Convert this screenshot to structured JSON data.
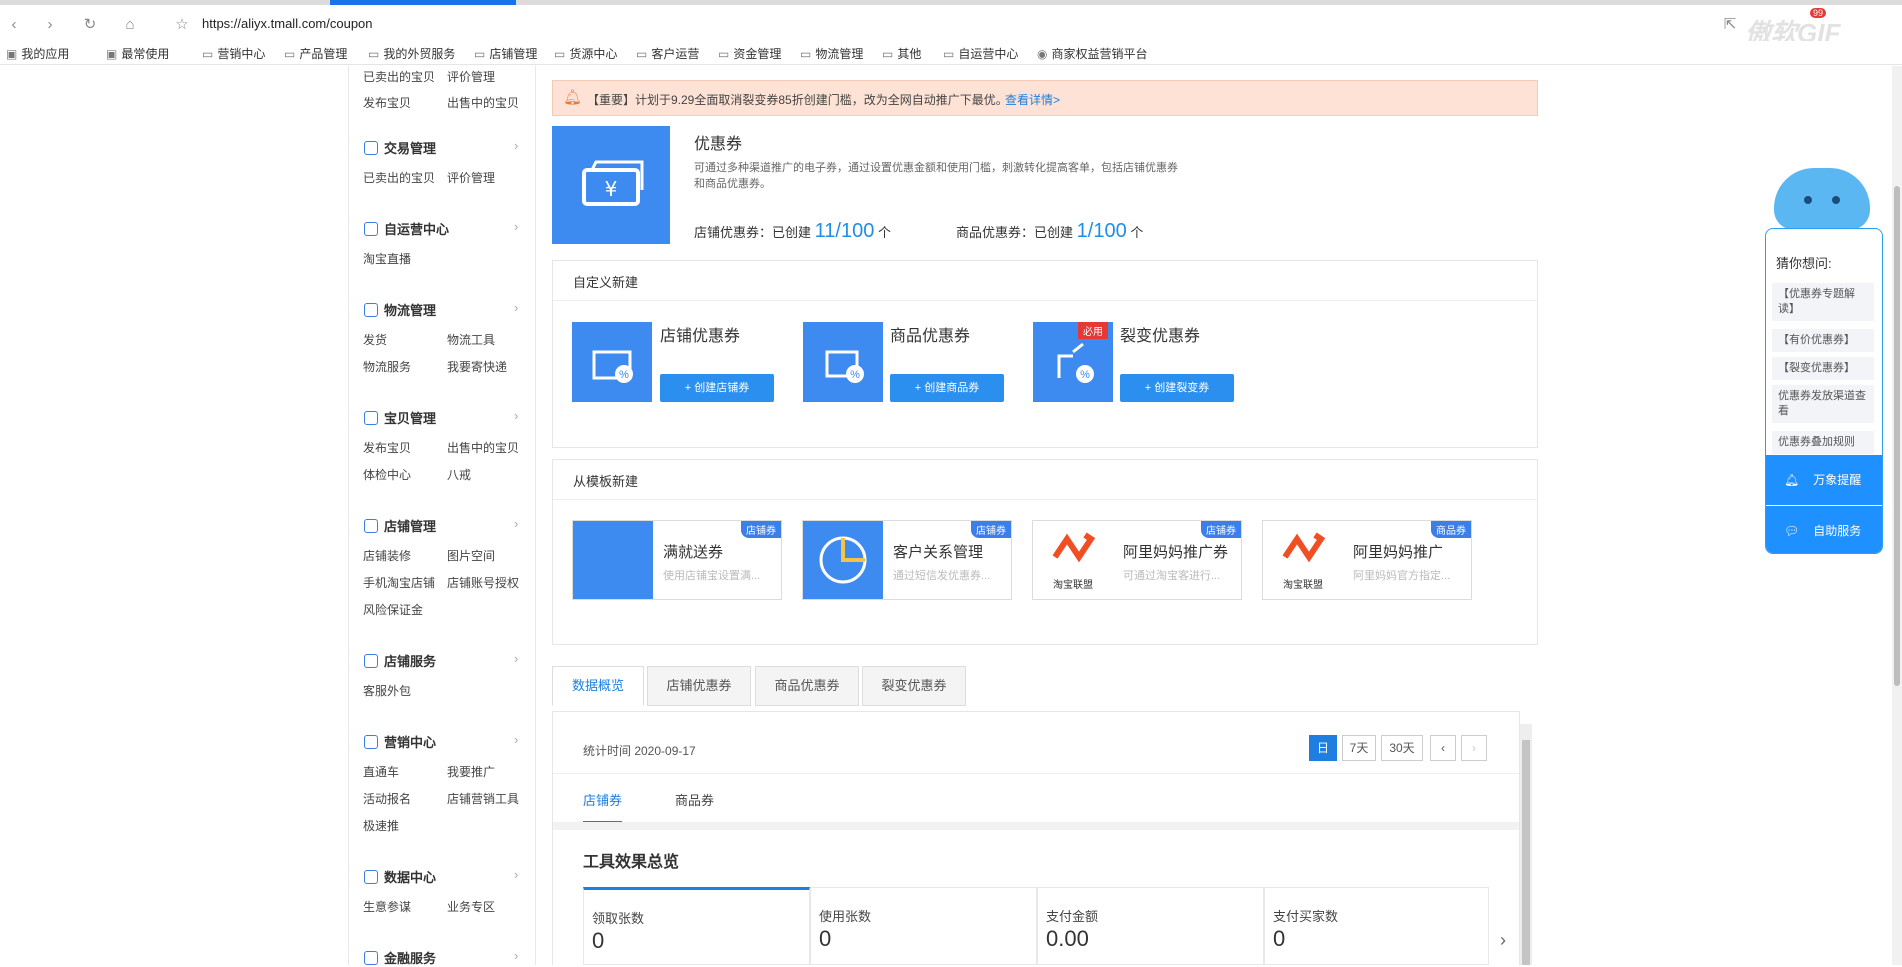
{
  "browser": {
    "url": "https://aliyx.tmall.com/coupon",
    "watermark": "傲软GIF",
    "badge": "99"
  },
  "bookmarks": [
    "我的应用",
    "最常使用",
    "营销中心",
    "产品管理",
    "我的外贸服务",
    "店铺管理",
    "货源中心",
    "客户运营",
    "资金管理",
    "物流管理",
    "其他",
    "自运营中心",
    "商家权益营销平台"
  ],
  "sidebar": {
    "top_links": [
      "已卖出的宝贝",
      "评价管理",
      "发布宝贝",
      "出售中的宝贝"
    ],
    "sections": [
      {
        "title": "交易管理",
        "items": [
          "已卖出的宝贝",
          "评价管理"
        ]
      },
      {
        "title": "自运营中心",
        "items": [
          "淘宝直播"
        ]
      },
      {
        "title": "物流管理",
        "items": [
          "发货",
          "物流工具",
          "物流服务",
          "我要寄快递"
        ]
      },
      {
        "title": "宝贝管理",
        "items": [
          "发布宝贝",
          "出售中的宝贝",
          "体检中心",
          "八戒"
        ]
      },
      {
        "title": "店铺管理",
        "items": [
          "店铺装修",
          "图片空间",
          "手机淘宝店铺",
          "店铺账号授权",
          "风险保证金"
        ]
      },
      {
        "title": "店铺服务",
        "items": [
          "客服外包"
        ]
      },
      {
        "title": "营销中心",
        "items": [
          "直通车",
          "我要推广",
          "活动报名",
          "店铺营销工具",
          "极速推"
        ]
      },
      {
        "title": "数据中心",
        "items": [
          "生意参谋",
          "业务专区"
        ]
      },
      {
        "title": "金融服务",
        "items": []
      }
    ]
  },
  "notice": {
    "text": "【重要】计划于9.29全面取消裂变券85折创建门槛，改为全网自动推广下最优。",
    "link": "查看详情>"
  },
  "coupon": {
    "title": "优惠券",
    "desc": "可通过多种渠道推广的电子券，通过设置优惠金额和使用门槛，刺激转化提高客单，包括店铺优惠券和商品优惠券。",
    "shop_label": "店铺优惠券：已创建",
    "shop_count": "11/100",
    "unit": "个",
    "item_label": "商品优惠券：已创建",
    "item_count": "1/100"
  },
  "custom": {
    "header": "自定义新建",
    "cards": [
      {
        "title": "店铺优惠券",
        "button": "+ 创建店铺券"
      },
      {
        "title": "商品优惠券",
        "button": "+ 创建商品券"
      },
      {
        "title": "裂变优惠券",
        "button": "+ 创建裂变券",
        "badge": "必用"
      }
    ]
  },
  "template": {
    "header": "从模板新建",
    "cards": [
      {
        "title": "满就送券",
        "desc": "使用店铺宝设置满...",
        "tag": "店铺券"
      },
      {
        "title": "客户关系管理",
        "desc": "通过短信发优惠券...",
        "tag": "店铺券"
      },
      {
        "title": "阿里妈妈推广券",
        "desc": "可通过淘宝客进行...",
        "tag": "店铺券",
        "logo": "淘宝联盟"
      },
      {
        "title": "阿里妈妈推广",
        "desc": "阿里妈妈官方指定...",
        "tag": "商品券",
        "logo": "淘宝联盟"
      }
    ]
  },
  "tabs": [
    "数据概览",
    "店铺优惠券",
    "商品优惠券",
    "裂变优惠券"
  ],
  "stats": {
    "time": "统计时间 2020-09-17",
    "ranges": [
      "日",
      "7天",
      "30天"
    ],
    "subtabs": [
      "店铺券",
      "商品券"
    ],
    "overview": "工具效果总览",
    "kpis": [
      {
        "label": "领取张数",
        "value": "0"
      },
      {
        "label": "使用张数",
        "value": "0"
      },
      {
        "label": "支付金额",
        "value": "0.00"
      },
      {
        "label": "支付买家数",
        "value": "0"
      }
    ]
  },
  "widget": {
    "title": "猜你想问:",
    "questions": [
      "【优惠券专题解读】",
      "【有价优惠券】",
      "【裂变优惠券】",
      "优惠券发放渠道查看",
      "优惠券叠加规则"
    ],
    "remind": "万象提醒",
    "service": "自助服务"
  },
  "colors": {
    "accent": "#1e90ff",
    "notice_bg": "#fde2d5",
    "tile": "#3d8af0"
  }
}
